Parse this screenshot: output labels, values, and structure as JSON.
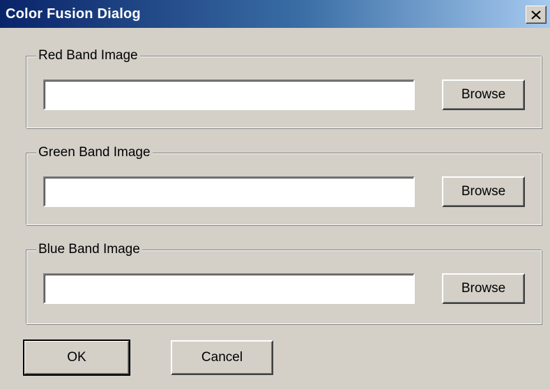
{
  "window": {
    "title": "Color Fusion Dialog",
    "close_glyph": "close-icon"
  },
  "groups": [
    {
      "legend": "Red Band Image",
      "value": "",
      "browse_label": "Browse"
    },
    {
      "legend": "Green Band Image",
      "value": "",
      "browse_label": "Browse"
    },
    {
      "legend": "Blue Band Image",
      "value": "",
      "browse_label": "Browse"
    }
  ],
  "footer": {
    "ok_label": "OK",
    "cancel_label": "Cancel"
  },
  "colors": {
    "titlebar_start": "#0a246a",
    "titlebar_end": "#a6caf0",
    "dialog_face": "#d4d0c8"
  }
}
